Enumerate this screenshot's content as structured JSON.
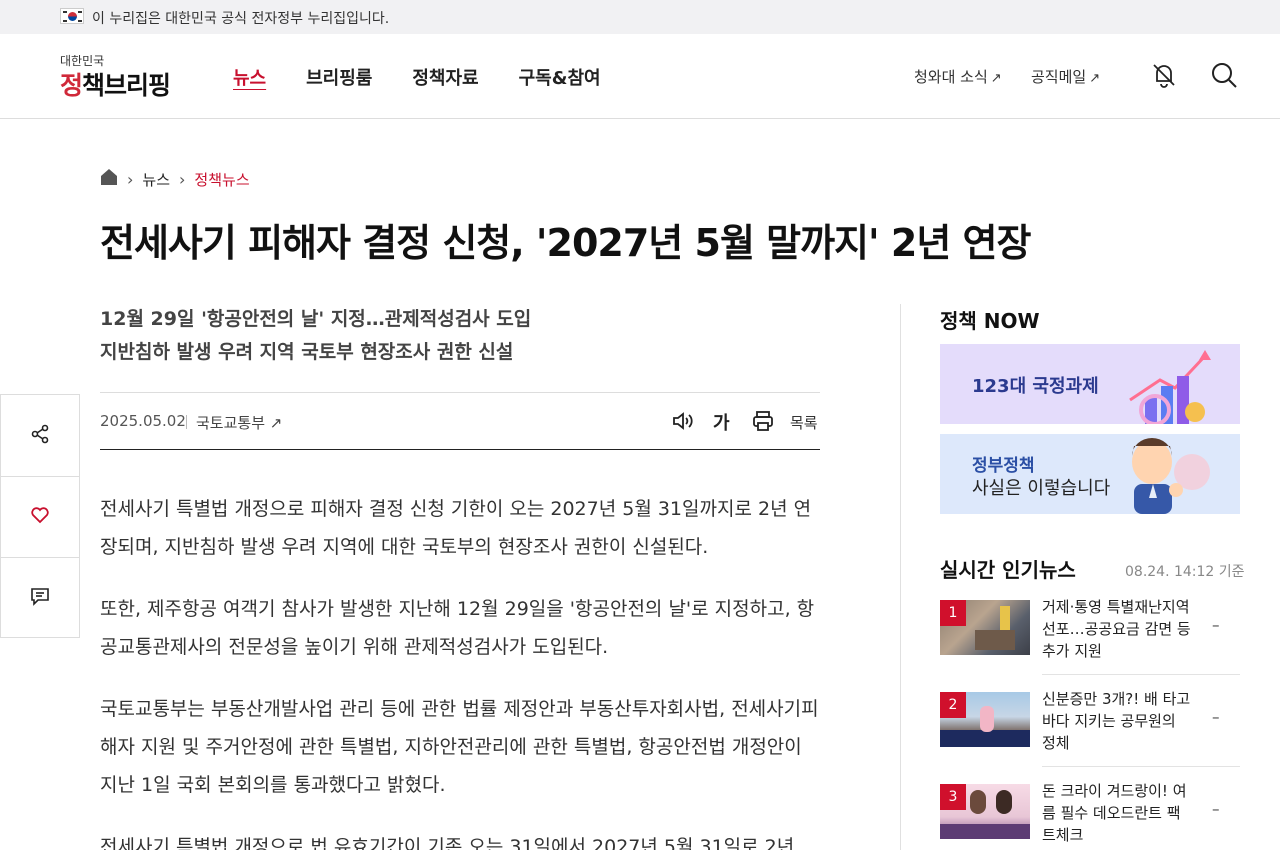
{
  "govbar": {
    "text": "이 누리집은 대한민국 공식 전자정부 누리집입니다."
  },
  "logo": {
    "top": "대한민국",
    "main_a": "정",
    "main_b": "책브리핑"
  },
  "nav": [
    {
      "label": "뉴스",
      "active": true
    },
    {
      "label": "브리핑룸",
      "active": false
    },
    {
      "label": "정책자료",
      "active": false
    },
    {
      "label": "구독&참여",
      "active": false
    }
  ],
  "header_links": {
    "cheongwadae": "청와대 소식",
    "mail": "공직메일",
    "arrow": "↗"
  },
  "header_icons": {
    "notify": "bell-off-icon",
    "search": "search-icon"
  },
  "breadcrumb": {
    "home_icon": "home-icon",
    "level1": "뉴스",
    "level2": "정책뉴스",
    "separator": "›"
  },
  "article": {
    "title": "전세사기 피해자 결정 신청, '2027년 5월 말까지' 2년 연장",
    "subtitle_1": "12월 29일 '항공안전의 날' 지정…관제적성검사 도입",
    "subtitle_2": "지반침하 발생 우려 지역 국토부 현장조사 권한 신설",
    "date": "2025.05.02",
    "department": "국토교통부 ↗",
    "font_button": "가",
    "list_button": "목록",
    "paragraphs": [
      "전세사기 특별법 개정으로 피해자 결정 신청 기한이 오는 2027년 5월 31일까지로 2년 연장되며, 지반침하 발생 우려 지역에 대한 국토부의 현장조사 권한이 신설된다.",
      "또한, 제주항공 여객기 참사가 발생한 지난해 12월 29일을 '항공안전의 날'로 지정하고, 항공교통관제사의 전문성을 높이기 위해 관제적성검사가 도입된다.",
      "국토교통부는 부동산개발사업 관리 등에 관한 법률 제정안과 부동산투자회사법, 전세사기피해자 지원 및 주거안정에 관한 특별법, 지하안전관리에 관한 특별법, 항공안전법 개정안이 지난 1일 국회 본회의를 통과했다고 밝혔다.",
      "전세사기 특별법 개정으로 법 유효기간이 기존 오는 31일에서 2027년 5월 31일로 2년"
    ]
  },
  "sidebar": {
    "policy_now": "정책 NOW",
    "banner1": "123대 국정과제",
    "banner2_line1": "정부정책",
    "banner2_line2": "사실은 이렇습니다",
    "popular_title": "실시간 인기뉴스",
    "popular_time": "08.24. 14:12 기준",
    "popular": [
      {
        "rank": "1",
        "text": "거제·통영 특별재난지역 선포…공공요금 감면 등 추가 지원",
        "dash": "–"
      },
      {
        "rank": "2",
        "text": "신분증만 3개?! 배 타고 바다 지키는 공무원의 정체",
        "dash": "–"
      },
      {
        "rank": "3",
        "text": "돈 크라이 겨드랑이! 여름 필수 데오드란트 팩트체크",
        "dash": "–"
      }
    ]
  },
  "float_buttons": [
    "share-icon",
    "heart-icon",
    "comment-icon"
  ]
}
